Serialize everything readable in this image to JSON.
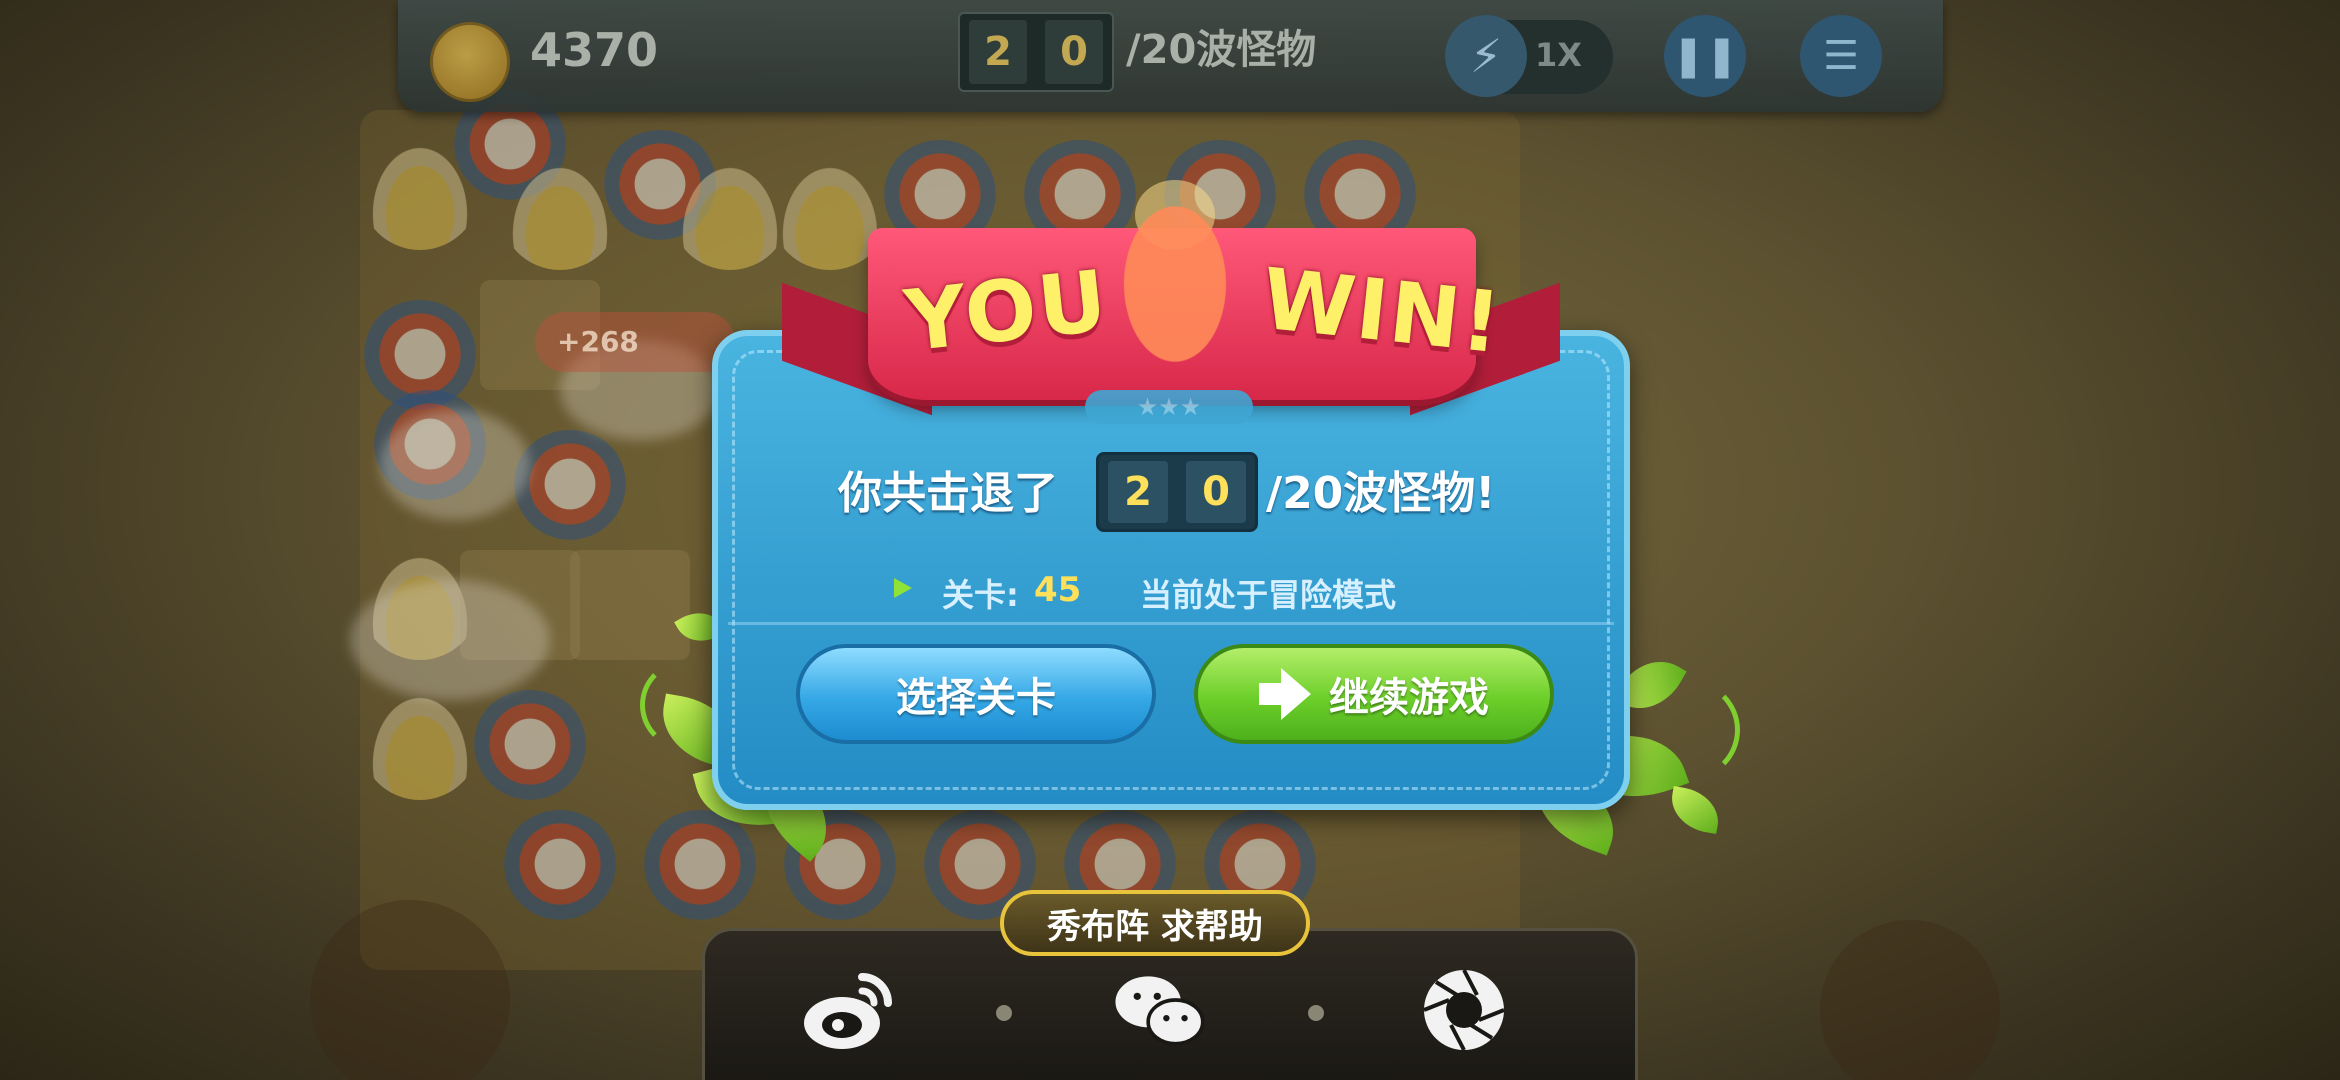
{
  "hud": {
    "coins": "4370",
    "wave_digits": [
      "2",
      "0"
    ],
    "wave_total": "/20波怪物",
    "speed": "1X",
    "icons": {
      "coin": "carrot-coin-icon",
      "speed": "lightning-icon",
      "pause": "pause-icon",
      "menu": "menu-icon"
    }
  },
  "board": {
    "bonus_popup": "+268"
  },
  "dialog": {
    "title_you": "YOU",
    "title_win": "WIN!",
    "stars": "★★★",
    "result_prefix": "你共击退了",
    "result_digits": [
      "2",
      "0"
    ],
    "result_suffix": "/20波怪物!",
    "level_label": "关卡:",
    "level_value": "45",
    "mode_text": "当前处于冒险模式",
    "select_level_button": "选择关卡",
    "continue_button": "继续游戏"
  },
  "share": {
    "tab_label": "秀布阵 求帮助",
    "items": [
      {
        "name": "weibo-icon"
      },
      {
        "name": "wechat-icon"
      },
      {
        "name": "camera-shutter-icon"
      }
    ]
  },
  "colors": {
    "panel_blue": "#2f9fd6",
    "ribbon_red": "#e83558",
    "title_yellow": "#fff06a",
    "green_button": "#6ccf2a",
    "blue_button": "#35a8e6",
    "share_gold": "#e8c33c"
  }
}
